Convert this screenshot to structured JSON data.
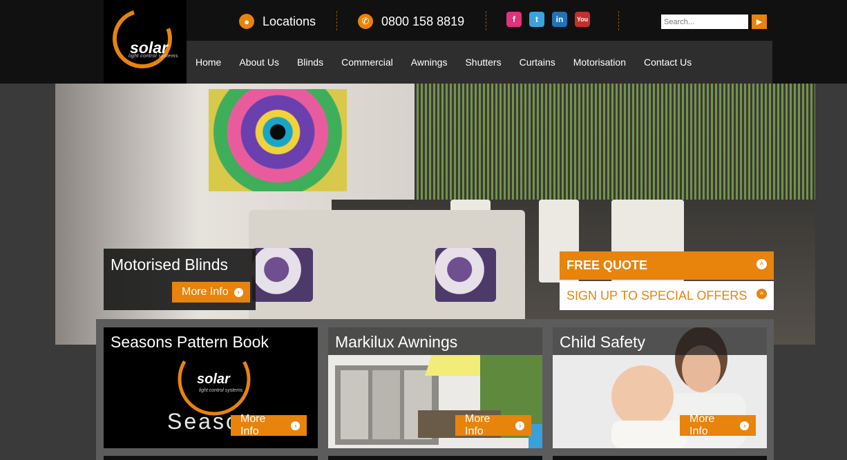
{
  "header": {
    "logo": {
      "word": "solar",
      "tagline": "light control systems"
    },
    "locations_label": "Locations",
    "phone": "0800 158 8819",
    "social": [
      {
        "name": "facebook",
        "glyph": "f",
        "color": "#e0337a"
      },
      {
        "name": "twitter",
        "glyph": "t",
        "color": "#3aa3d9"
      },
      {
        "name": "linkedin",
        "glyph": "in",
        "color": "#1f73b7"
      },
      {
        "name": "youtube",
        "glyph": "You",
        "color": "#c4302b"
      }
    ],
    "search_placeholder": "Search..."
  },
  "nav": [
    "Home",
    "About Us",
    "Blinds",
    "Commercial",
    "Awnings",
    "Shutters",
    "Curtains",
    "Motorisation",
    "Contact Us"
  ],
  "hero": {
    "caption_title": "Motorised Blinds",
    "more_label": "More Info"
  },
  "side_bars": {
    "quote_label": "FREE QUOTE",
    "offers_label": "SIGN UP TO SPECIAL OFFERS"
  },
  "cards": [
    {
      "title": "Seasons Pattern Book",
      "more_label": "More Info",
      "logo_word": "solar",
      "logo_tagline": "light control systems",
      "fragment": "Seaso"
    },
    {
      "title": "Markilux Awnings",
      "more_label": "More Info"
    },
    {
      "title": "Child Safety",
      "more_label": "More Info"
    }
  ],
  "colors": {
    "accent": "#e8830c",
    "dark": "#111111"
  }
}
